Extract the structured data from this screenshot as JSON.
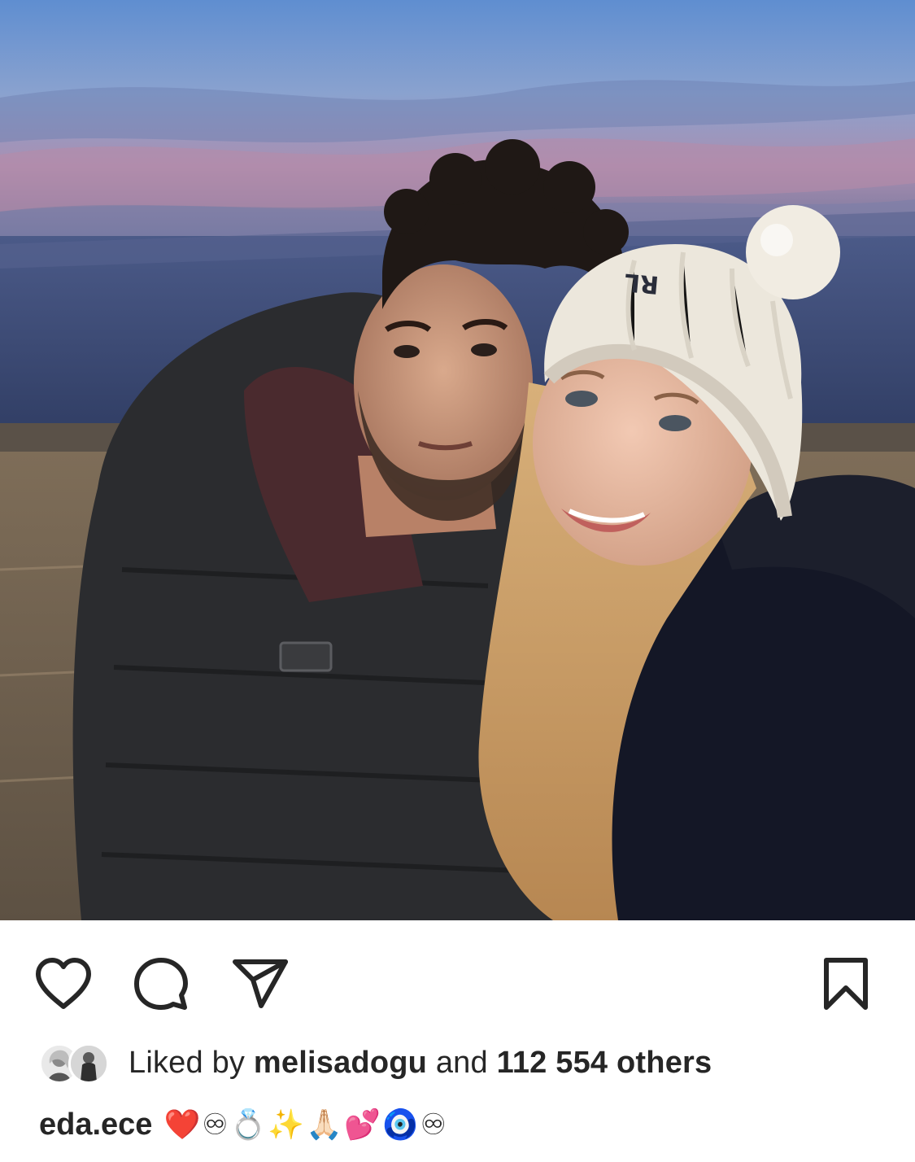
{
  "post": {
    "photo_alt": "",
    "colors": {
      "text": "#262626",
      "icon": "#262626",
      "heart_red": "#e0202c"
    }
  },
  "actions": {
    "like_icon": "heart-icon",
    "comment_icon": "comment-bubble-icon",
    "share_icon": "paper-plane-icon",
    "save_icon": "bookmark-icon"
  },
  "likes": {
    "prefix": "Liked by ",
    "username": "melisadogu",
    "middle": " and ",
    "count_text": "112 554 others"
  },
  "caption": {
    "username": "eda.ece",
    "emoji_text": "❤️♾💍✨🙏🏻💕🧿♾"
  }
}
